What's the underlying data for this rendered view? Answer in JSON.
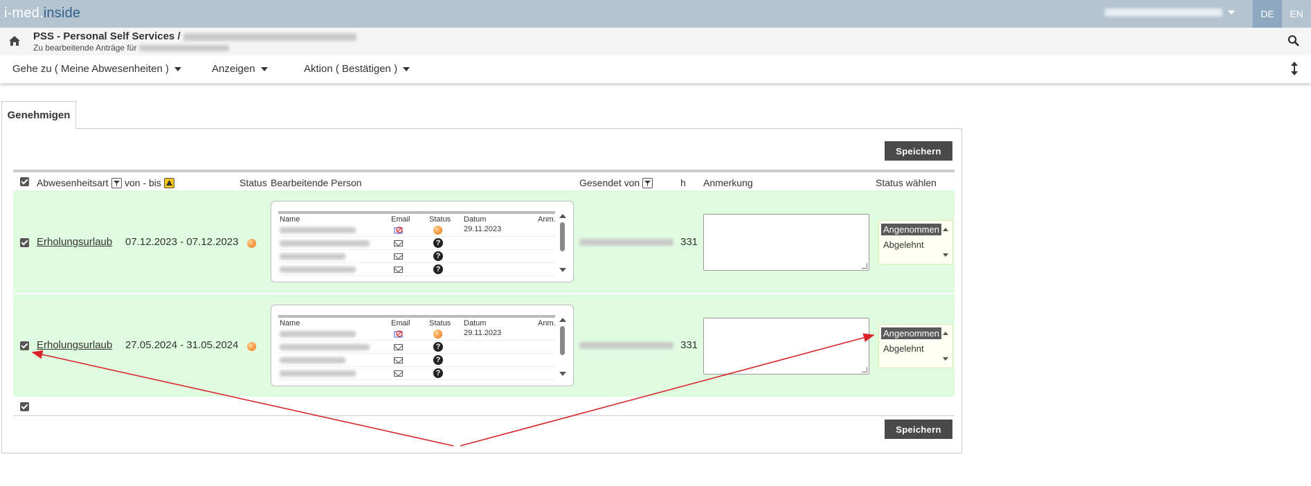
{
  "brand": {
    "logo_a": "i-med.",
    "logo_b": "inside"
  },
  "topbar": {
    "lang_de": "DE",
    "lang_en": "EN"
  },
  "breadcrumb": {
    "title": "PSS - Personal Self Services /",
    "subtitle": "Zu bearbeitende Anträge für"
  },
  "nav": {
    "goto": "Gehe zu ( Meine Abwesenheiten )",
    "show": "Anzeigen",
    "action": "Aktion ( Bestätigen )"
  },
  "tab": {
    "label": "Genehmigen"
  },
  "buttons": {
    "save_top": "Speichern",
    "save_bottom": "Speichern"
  },
  "table": {
    "headers": {
      "type": "Abwesenheitsart",
      "range": "von - bis",
      "status": "Status",
      "person": "Bearbeitende Person",
      "sent_by": "Gesendet von",
      "h": "h",
      "note": "Anmerkung",
      "choose": "Status wählen"
    },
    "person_box_headers": {
      "name": "Name",
      "email": "Email",
      "status": "Status",
      "date": "Datum",
      "note": "Anm."
    },
    "rows": [
      {
        "type": "Erholungsurlaub",
        "range": "07.12.2023 - 07.12.2023",
        "hours": "331",
        "first_date": "29.11.2023",
        "options": [
          "Angenommen",
          "Abgelehnt"
        ],
        "selected": "Angenommen"
      },
      {
        "type": "Erholungsurlaub",
        "range": "27.05.2024 - 31.05.2024",
        "hours": "331",
        "first_date": "29.11.2023",
        "options": [
          "Angenommen",
          "Abgelehnt"
        ],
        "selected": "Angenommen"
      }
    ]
  },
  "colors": {
    "topbar": "#b3c3cf",
    "row_bg": "#e0fce0",
    "button": "#4a4a4a",
    "arrow": "#d9252a"
  },
  "icons": [
    "home-icon",
    "search-icon",
    "filter-icon",
    "sort-icon",
    "mail-icon",
    "question-icon",
    "resize-icon"
  ]
}
